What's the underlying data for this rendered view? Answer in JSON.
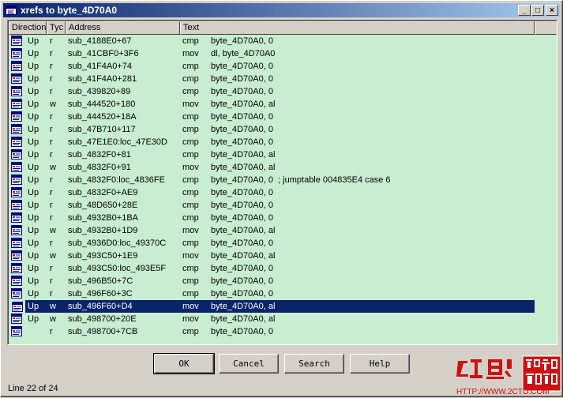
{
  "window": {
    "title": "xrefs to byte_4D70A0"
  },
  "titlebar_buttons": {
    "minimize": "_",
    "maximize": "□",
    "close": "×"
  },
  "columns": [
    "Direction",
    "Tyc",
    "Address",
    "Text"
  ],
  "rows": [
    {
      "dir": "Up",
      "type": "r",
      "addr": "sub_4188E0+67",
      "text": "cmp     byte_4D70A0, 0"
    },
    {
      "dir": "Up",
      "type": "r",
      "addr": "sub_41CBF0+3F6",
      "text": "mov     dl, byte_4D70A0"
    },
    {
      "dir": "Up",
      "type": "r",
      "addr": "sub_41F4A0+74",
      "text": "cmp     byte_4D70A0, 0"
    },
    {
      "dir": "Up",
      "type": "r",
      "addr": "sub_41F4A0+281",
      "text": "cmp     byte_4D70A0, 0"
    },
    {
      "dir": "Up",
      "type": "r",
      "addr": "sub_439820+89",
      "text": "cmp     byte_4D70A0, 0"
    },
    {
      "dir": "Up",
      "type": "w",
      "addr": "sub_444520+180",
      "text": "mov     byte_4D70A0, al"
    },
    {
      "dir": "Up",
      "type": "r",
      "addr": "sub_444520+18A",
      "text": "cmp     byte_4D70A0, 0"
    },
    {
      "dir": "Up",
      "type": "r",
      "addr": "sub_47B710+117",
      "text": "cmp     byte_4D70A0, 0"
    },
    {
      "dir": "Up",
      "type": "r",
      "addr": "sub_47E1E0:loc_47E30D",
      "text": "cmp     byte_4D70A0, 0"
    },
    {
      "dir": "Up",
      "type": "r",
      "addr": "sub_4832F0+81",
      "text": "cmp     byte_4D70A0, al"
    },
    {
      "dir": "Up",
      "type": "w",
      "addr": "sub_4832F0+91",
      "text": "mov     byte_4D70A0, al"
    },
    {
      "dir": "Up",
      "type": "r",
      "addr": "sub_4832F0:loc_4836FE",
      "text": "cmp     byte_4D70A0, 0  ; jumptable 004835E4 case 6"
    },
    {
      "dir": "Up",
      "type": "r",
      "addr": "sub_4832F0+AE9",
      "text": "cmp     byte_4D70A0, 0"
    },
    {
      "dir": "Up",
      "type": "r",
      "addr": "sub_48D650+28E",
      "text": "cmp     byte_4D70A0, 0"
    },
    {
      "dir": "Up",
      "type": "r",
      "addr": "sub_4932B0+1BA",
      "text": "cmp     byte_4D70A0, 0"
    },
    {
      "dir": "Up",
      "type": "w",
      "addr": "sub_4932B0+1D9",
      "text": "mov     byte_4D70A0, al"
    },
    {
      "dir": "Up",
      "type": "r",
      "addr": "sub_4936D0:loc_49370C",
      "text": "cmp     byte_4D70A0, 0"
    },
    {
      "dir": "Up",
      "type": "w",
      "addr": "sub_493C50+1E9",
      "text": "mov     byte_4D70A0, al"
    },
    {
      "dir": "Up",
      "type": "r",
      "addr": "sub_493C50:loc_493E5F",
      "text": "cmp     byte_4D70A0, 0"
    },
    {
      "dir": "Up",
      "type": "r",
      "addr": "sub_496B50+7C",
      "text": "cmp     byte_4D70A0, 0"
    },
    {
      "dir": "Up",
      "type": "r",
      "addr": "sub_496F60+3C",
      "text": "cmp     byte_4D70A0, 0"
    },
    {
      "dir": "Up",
      "type": "w",
      "addr": "sub_496F60+D4",
      "text": "mov     byte_4D70A0, al",
      "selected": true
    },
    {
      "dir": "Up",
      "type": "w",
      "addr": "sub_498700+20E",
      "text": "mov     byte_4D70A0, al"
    },
    {
      "dir": "",
      "type": "r",
      "addr": "sub_498700+7CB",
      "text": "cmp     byte_4D70A0, 0"
    }
  ],
  "buttons": {
    "ok": "OK",
    "cancel": "Cancel",
    "search": "Search",
    "help": "Help"
  },
  "status": "Line 22 of 24",
  "watermark": {
    "url": "HTTP://WWW.2CTO.COM"
  },
  "colors": {
    "list_bg": "#c8edd0",
    "selection": "#0a246a",
    "title_start": "#0a246a",
    "title_end": "#a6caf0",
    "watermark_red": "#cc1111"
  }
}
